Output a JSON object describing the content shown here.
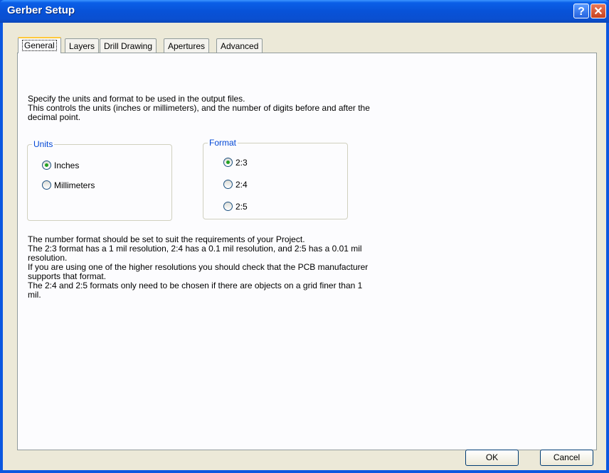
{
  "window": {
    "title": "Gerber Setup",
    "help": "?",
    "close": "✕"
  },
  "tabs": [
    {
      "label": "General",
      "active": true
    },
    {
      "label": "Layers"
    },
    {
      "label": "Drill Drawing"
    },
    {
      "label": "Apertures"
    },
    {
      "label": "Advanced"
    }
  ],
  "intro": "Specify the units and format to be used in the output files.\nThis controls the units (inches or millimeters), and the number of digits before and after the\ndecimal point.",
  "units": {
    "label": "Units",
    "options": [
      {
        "label": "Inches",
        "checked": true
      },
      {
        "label": "Millimeters",
        "checked": false
      }
    ]
  },
  "format": {
    "label": "Format",
    "options": [
      {
        "label": "2:3",
        "checked": true
      },
      {
        "label": "2:4",
        "checked": false
      },
      {
        "label": "2:5",
        "checked": false
      }
    ]
  },
  "notes": "The number format should be set to suit the requirements of your Project.\nThe 2:3 format has a 1 mil resolution, 2:4 has a 0.1 mil resolution, and 2:5 has a 0.01 mil\nresolution.\nIf you are using one of the higher resolutions you should check that the PCB manufacturer\nsupports that format.\nThe 2:4 and 2:5 formats only need to be chosen if there are objects on a grid finer than 1\nmil.",
  "buttons": {
    "ok": "OK",
    "cancel": "Cancel"
  }
}
